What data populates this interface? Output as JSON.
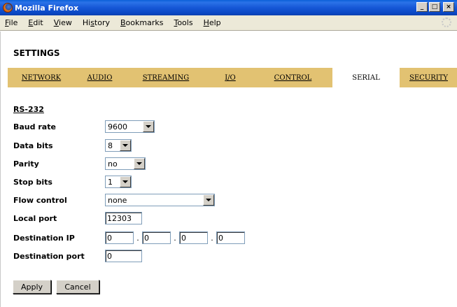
{
  "window": {
    "title": "Mozilla Firefox",
    "min": "_",
    "max": "□",
    "close": "×"
  },
  "menu": [
    {
      "pre": "",
      "key": "F",
      "post": "ile"
    },
    {
      "pre": "",
      "key": "E",
      "post": "dit"
    },
    {
      "pre": "",
      "key": "V",
      "post": "iew"
    },
    {
      "pre": "Hi",
      "key": "s",
      "post": "tory"
    },
    {
      "pre": "",
      "key": "B",
      "post": "ookmarks"
    },
    {
      "pre": "",
      "key": "T",
      "post": "ools"
    },
    {
      "pre": "",
      "key": "H",
      "post": "elp"
    }
  ],
  "page": {
    "title": "SETTINGS"
  },
  "tabs": [
    {
      "label": "NETWORK"
    },
    {
      "label": "AUDIO"
    },
    {
      "label": "STREAMING"
    },
    {
      "label": "I/O"
    },
    {
      "label": "CONTROL"
    },
    {
      "label": "SERIAL",
      "active": true
    },
    {
      "label": "SECURITY"
    }
  ],
  "form": {
    "section": "RS-232",
    "baud_rate": {
      "label": "Baud rate",
      "value": "9600"
    },
    "data_bits": {
      "label": "Data bits",
      "value": "8"
    },
    "parity": {
      "label": "Parity",
      "value": "no"
    },
    "stop_bits": {
      "label": "Stop bits",
      "value": "1"
    },
    "flow_control": {
      "label": "Flow control",
      "value": "none"
    },
    "local_port": {
      "label": "Local port",
      "value": "12303"
    },
    "destination_ip": {
      "label": "Destination IP",
      "octets": [
        "0",
        "0",
        "0",
        "0"
      ],
      "separator": "."
    },
    "destination_port": {
      "label": "Destination port",
      "value": "0"
    }
  },
  "buttons": {
    "apply": "Apply",
    "cancel": "Cancel"
  },
  "colors": {
    "tab_bar": "#e2c272",
    "titlebar": "#1657d6"
  }
}
